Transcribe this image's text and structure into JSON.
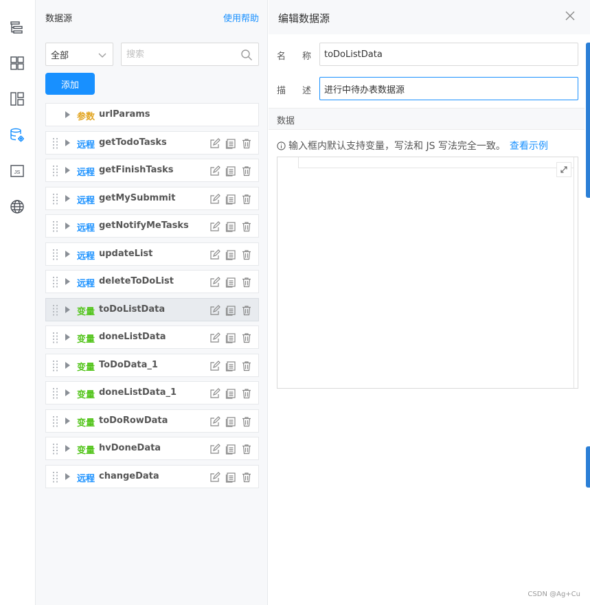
{
  "rail": {
    "items": [
      {
        "icon": "outline-icon"
      },
      {
        "icon": "components-icon"
      },
      {
        "icon": "layout-icon"
      },
      {
        "icon": "datasource-icon"
      },
      {
        "icon": "js-icon",
        "label": "JS"
      },
      {
        "icon": "globe-icon"
      }
    ],
    "active_color": "#1890ff"
  },
  "panel": {
    "title": "数据源",
    "help": "使用帮助",
    "filter": {
      "selected": "全部"
    },
    "search": {
      "placeholder": "搜索",
      "value": ""
    },
    "add_label": "添加",
    "items": [
      {
        "type": "参数",
        "kind": "param",
        "name": "urlParams",
        "actions": false
      },
      {
        "type": "远程",
        "kind": "remote",
        "name": "getTodoTasks",
        "actions": true
      },
      {
        "type": "远程",
        "kind": "remote",
        "name": "getFinishTasks",
        "actions": true
      },
      {
        "type": "远程",
        "kind": "remote",
        "name": "getMySubmmit",
        "actions": true
      },
      {
        "type": "远程",
        "kind": "remote",
        "name": "getNotifyMeTasks",
        "actions": true
      },
      {
        "type": "远程",
        "kind": "remote",
        "name": "updateList",
        "actions": true
      },
      {
        "type": "远程",
        "kind": "remote",
        "name": "deleteToDoList",
        "actions": true
      },
      {
        "type": "变量",
        "kind": "var",
        "name": "toDoListData",
        "actions": true,
        "selected": true
      },
      {
        "type": "变量",
        "kind": "var",
        "name": "doneListData",
        "actions": true
      },
      {
        "type": "变量",
        "kind": "var",
        "name": "ToDoData_1",
        "actions": true
      },
      {
        "type": "变量",
        "kind": "var",
        "name": "doneListData_1",
        "actions": true
      },
      {
        "type": "变量",
        "kind": "var",
        "name": "toDoRowData",
        "actions": true
      },
      {
        "type": "变量",
        "kind": "var",
        "name": "hvDoneData",
        "actions": true
      },
      {
        "type": "远程",
        "kind": "remote",
        "name": "changeData",
        "actions": true
      }
    ],
    "colors": {
      "remote": "#1890ff",
      "var": "#52c41a",
      "param": "#e2a521"
    }
  },
  "editor": {
    "title": "编辑数据源",
    "name_label_1": "名",
    "name_label_2": "称",
    "name_value": "toDoListData",
    "desc_label_1": "描",
    "desc_label_2": "述",
    "desc_value": "进行中待办表数据源",
    "section": "数据",
    "hint": "输入框内默认支持变量，写法和 JS 写法完全一致。",
    "example_link": "查看示例",
    "code": ""
  },
  "watermark": "CSDN @Ag+Cu"
}
